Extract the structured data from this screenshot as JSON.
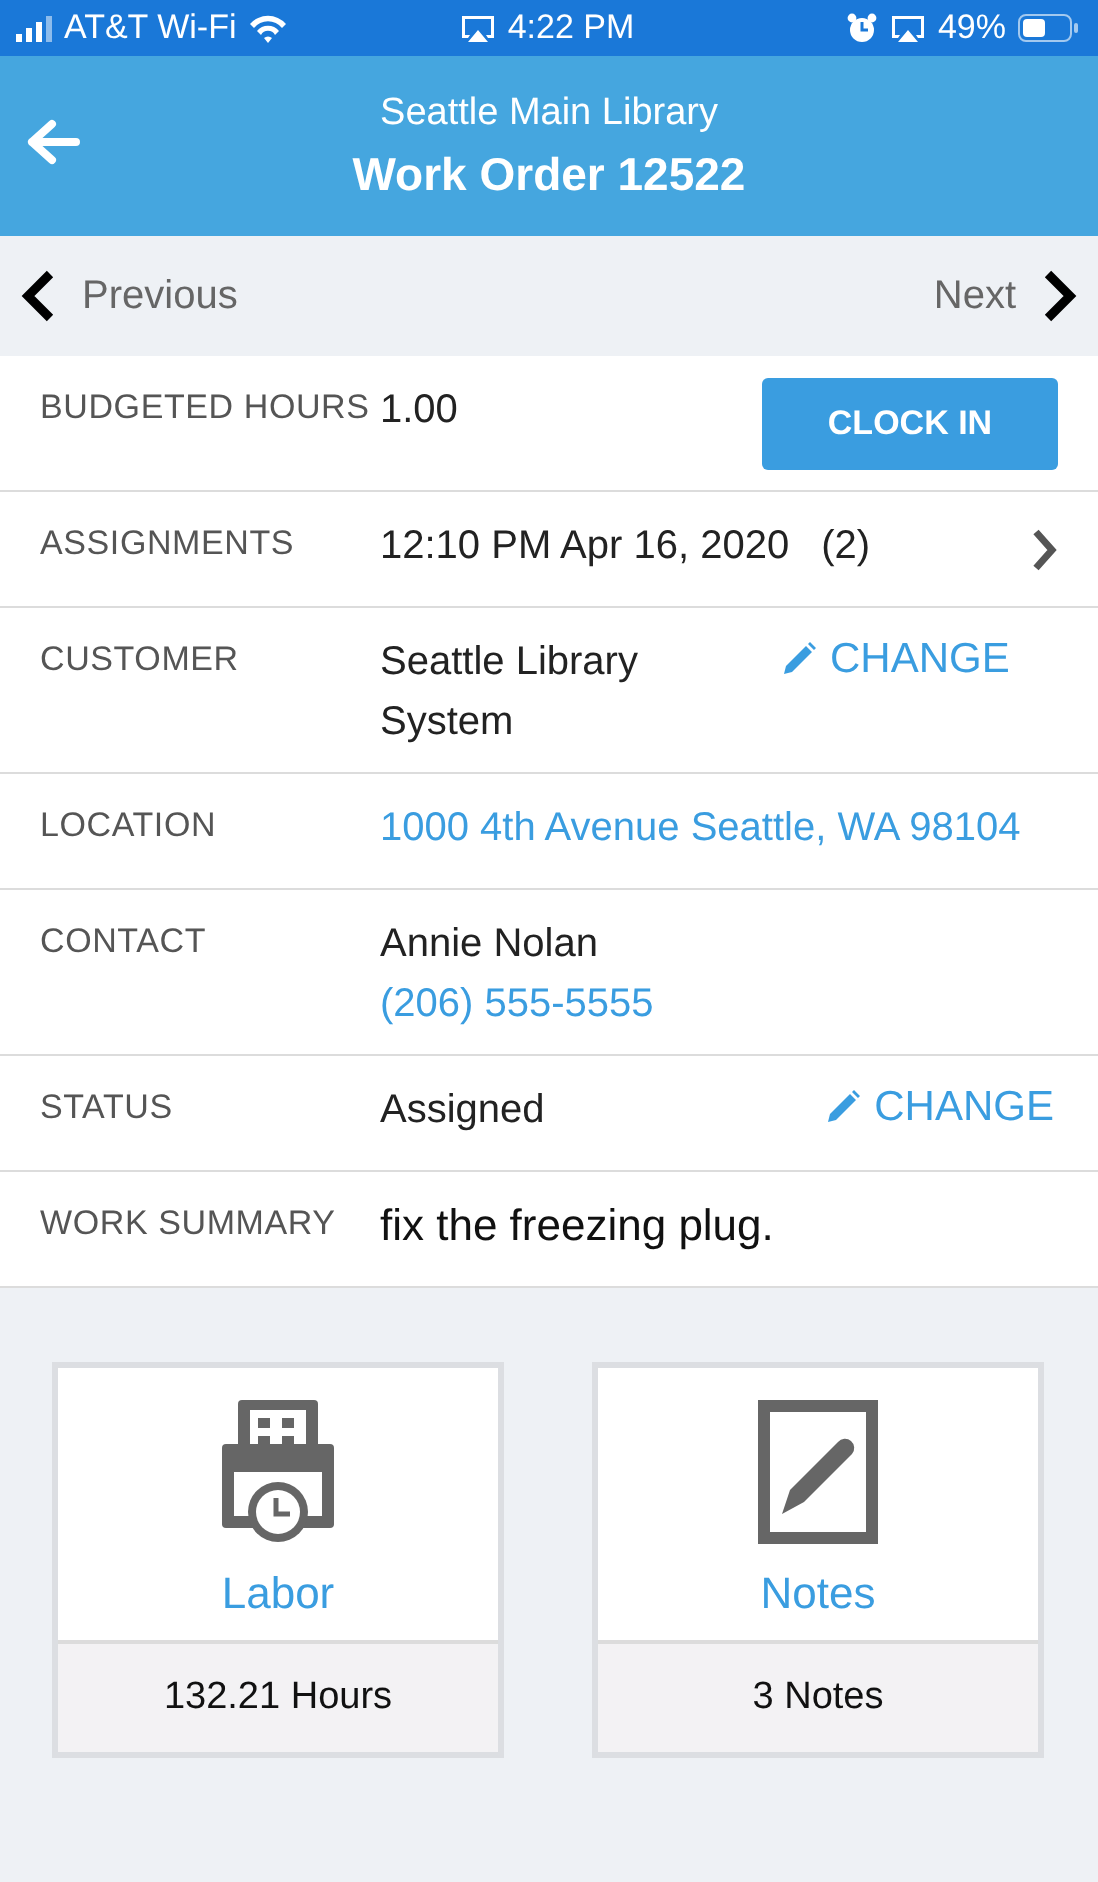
{
  "status_bar": {
    "carrier": "AT&T Wi-Fi",
    "time": "4:22 PM",
    "battery": "49%"
  },
  "header": {
    "subtitle": "Seattle Main Library",
    "title": "Work Order 12522"
  },
  "nav": {
    "previous": "Previous",
    "next": "Next"
  },
  "fields": [
    {
      "label": "BUDGETED HOURS",
      "values": [
        {
          "kind": "text",
          "text": "1.00"
        }
      ],
      "action": {
        "kind": "button",
        "label": "CLOCK IN"
      }
    },
    {
      "label": "ASSIGNMENTS",
      "values": [
        {
          "kind": "text",
          "text": "12:10 PM Apr 16, 2020"
        }
      ],
      "count": "(2)",
      "action": {
        "kind": "chevron"
      }
    },
    {
      "label": "CUSTOMER",
      "values": [
        {
          "kind": "text",
          "text": "Seattle Library System"
        }
      ],
      "action": {
        "kind": "change",
        "label": "CHANGE"
      }
    },
    {
      "label": "LOCATION",
      "values": [
        {
          "kind": "link",
          "text": "1000 4th Avenue Seattle, WA 98104"
        }
      ]
    },
    {
      "label": "CONTACT",
      "values": [
        {
          "kind": "text",
          "text": "Annie Nolan"
        },
        {
          "kind": "link",
          "text": "(206) 555-5555"
        }
      ]
    },
    {
      "label": "STATUS",
      "values": [
        {
          "kind": "text",
          "text": "Assigned"
        }
      ],
      "action": {
        "kind": "change",
        "label": "CHANGE"
      }
    },
    {
      "label": "WORK SUMMARY",
      "values": [
        {
          "kind": "summary",
          "text": "fix the freezing plug."
        }
      ]
    }
  ],
  "tiles": [
    {
      "kind": "labor",
      "title": "Labor",
      "summary": "132.21 Hours"
    },
    {
      "kind": "notes",
      "title": "Notes",
      "summary": "3 Notes"
    }
  ]
}
